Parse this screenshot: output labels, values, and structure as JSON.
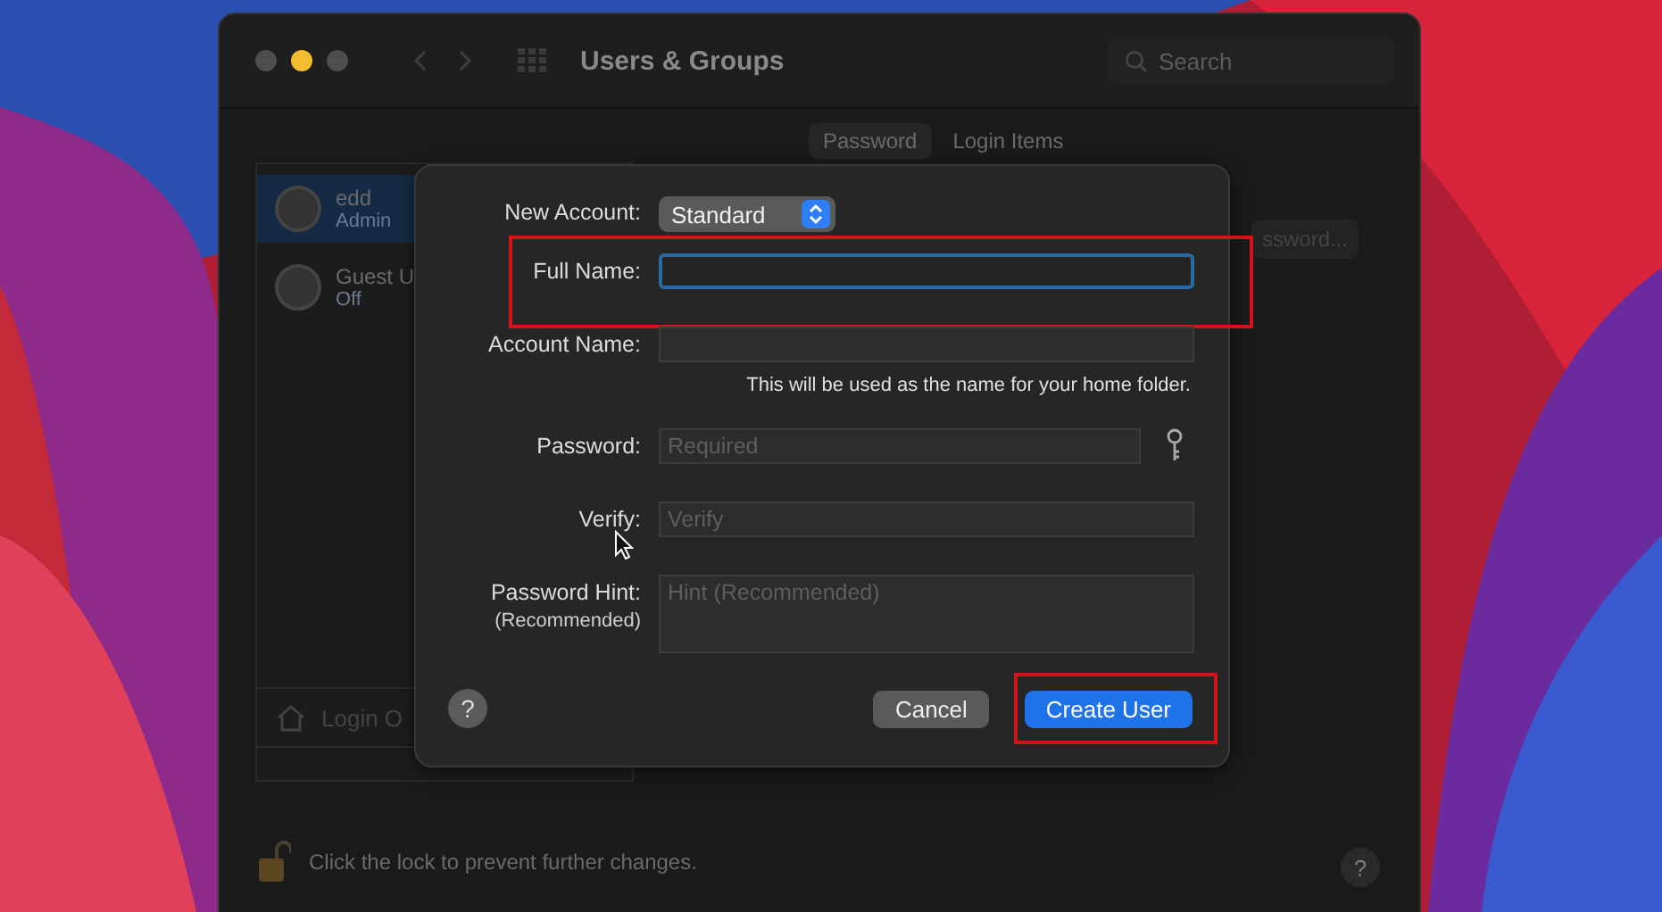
{
  "window": {
    "title": "Users & Groups",
    "search": {
      "placeholder": "Search"
    },
    "traffic_lights": [
      {
        "color": "#4e4e4e"
      },
      {
        "color": "#f4bc2f"
      },
      {
        "color": "#4e4e4e"
      }
    ]
  },
  "tabs": [
    {
      "label": "Password",
      "selected": true
    },
    {
      "label": "Login Items",
      "selected": false
    }
  ],
  "sidebar": {
    "users": [
      {
        "name": "edd",
        "role": "Admin",
        "selected": true
      },
      {
        "name": "Guest U",
        "role": "Off",
        "selected": false
      }
    ],
    "login_options": "Login O"
  },
  "change_password_button": "ssword...",
  "lock": {
    "text": "Click the lock to prevent further changes."
  },
  "window_help": "?",
  "sheet": {
    "fields": [
      {
        "kind": "popup",
        "label": "New Account:",
        "value": "Standard"
      },
      {
        "kind": "text",
        "label": "Full Name:",
        "focused": true,
        "highlighted": true
      },
      {
        "kind": "text",
        "label": "Account Name:",
        "note": "This will be used as the name for your home folder.",
        "focused": false
      },
      {
        "kind": "password",
        "label": "Password:",
        "placeholder": "Required",
        "focused": false
      },
      {
        "kind": "text",
        "label": "Verify:",
        "placeholder": "Verify",
        "focused": false
      },
      {
        "kind": "textarea",
        "label": "Password Hint:",
        "sublabel": "(Recommended)",
        "placeholder": "Hint (Recommended)",
        "focused": false
      }
    ],
    "help": "?",
    "buttons": [
      {
        "label": "Cancel",
        "kind": "secondary"
      },
      {
        "label": "Create User",
        "kind": "primary",
        "highlighted": true
      }
    ]
  }
}
